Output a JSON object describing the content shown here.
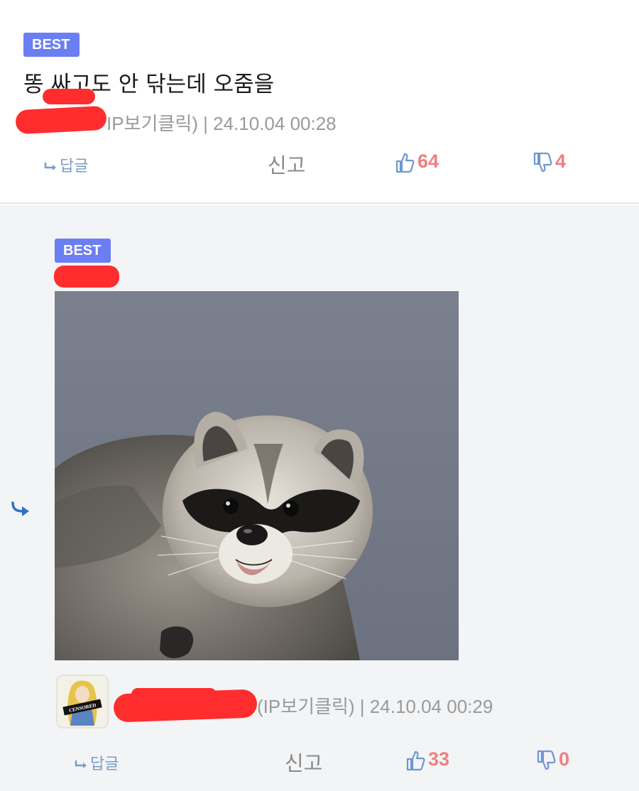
{
  "comment1": {
    "badge": "BEST",
    "text": "똥 싸고도 안 닦는데 오줌을",
    "ip_link": "IP보기클릭)",
    "separator": "|",
    "timestamp": "24.10.04 00:28",
    "reply_label": "답글",
    "report_label": "신고",
    "likes": "64",
    "dislikes": "4"
  },
  "comment2": {
    "badge": "BEST",
    "ip_link": "(IP보기클릭)",
    "separator": "|",
    "timestamp": "24.10.04 00:29",
    "avatar_caption": "CENSORED",
    "reply_label": "답글",
    "report_label": "신고",
    "likes": "33",
    "dislikes": "0"
  },
  "colors": {
    "badge": "#6b7ef2",
    "vote": "#f07f7f",
    "reply": "#7a9cc6",
    "redaction": "#ff2d2d",
    "thumb_icon": "#6f97cf"
  },
  "icons": [
    "reply-arrow-icon",
    "thumbs-up-icon",
    "thumbs-down-icon",
    "nested-reply-arrow-icon"
  ]
}
